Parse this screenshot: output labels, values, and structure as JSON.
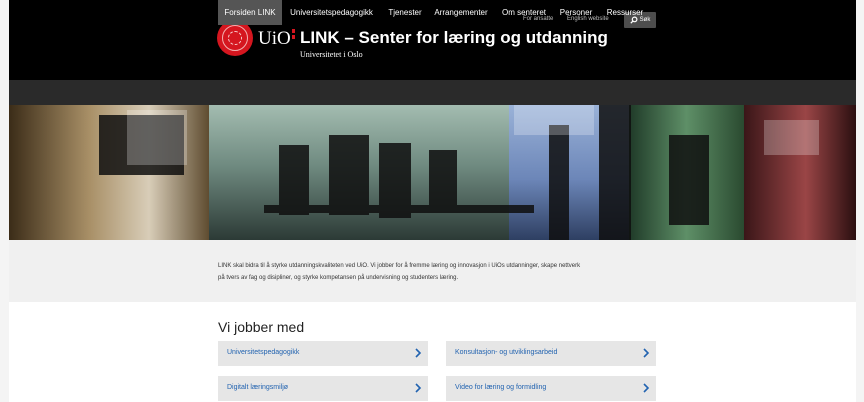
{
  "header": {
    "brand": "UiO",
    "title": "LINK – Senter for læring og utdanning",
    "subtitle": "Universitetet i Oslo",
    "top_links": [
      {
        "label": "For ansatte"
      },
      {
        "label": "English website"
      }
    ],
    "search_label": "Søk"
  },
  "nav": {
    "items": [
      {
        "label": "Forsiden LINK",
        "active": true
      },
      {
        "label": "Universitetspedagogikk"
      },
      {
        "label": "Tjenester"
      },
      {
        "label": "Arrangementer"
      },
      {
        "label": "Om senteret"
      },
      {
        "label": "Personer"
      },
      {
        "label": "Ressurser"
      }
    ]
  },
  "intro": {
    "line1": "LINK skal bidra til å styrke utdanningskvaliteten ved UiO. Vi jobber for å fremme læring og innovasjon i UiOs utdanninger, skape nettverk",
    "line2": "på tvers av fag og disipliner, og styrke kompetansen på undervisning og studenters læring."
  },
  "section": {
    "heading": "Vi jobber med",
    "cards": [
      {
        "label": "Universitetspedagogikk"
      },
      {
        "label": "Konsultasjon- og utviklingsarbeid"
      },
      {
        "label": "Digitalt læringsmiljø"
      },
      {
        "label": "Video for læring og formidling"
      }
    ]
  },
  "colors": {
    "header_bg": "#000000",
    "nav_bg": "#2a2a2a",
    "nav_active": "#555555",
    "uio_red": "#d5161f",
    "link_blue": "#2263b0",
    "card_bg": "#e6e6e6",
    "intro_bg": "#f0f0f0"
  },
  "icons": {
    "seal": "uio-seal-icon",
    "search": "search-icon",
    "chevron": "chevron-right-icon"
  }
}
